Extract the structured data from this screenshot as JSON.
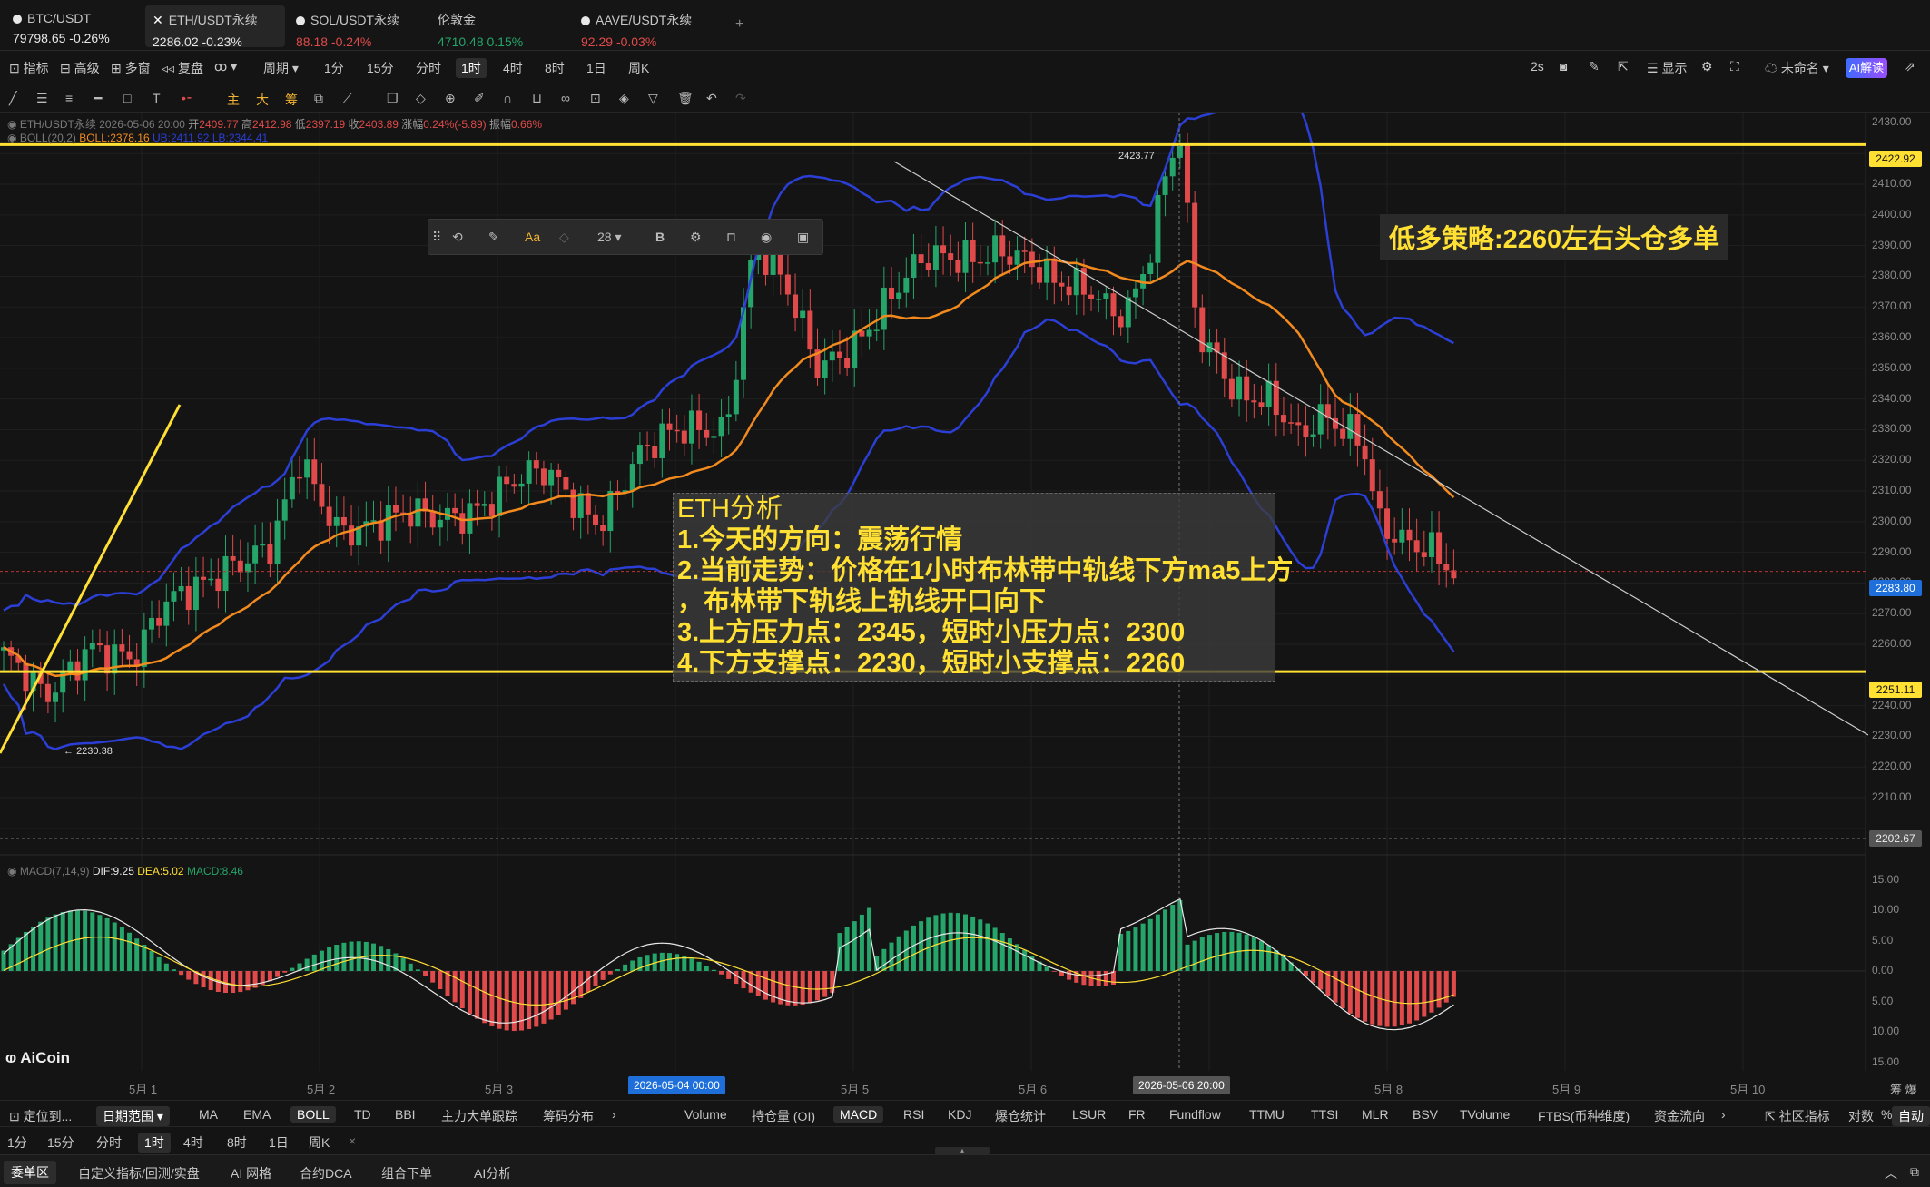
{
  "tabs": [
    {
      "name": "BTC/USDT",
      "price": "79798.65",
      "change": "-0.26%",
      "price_color": "#e8e8e8",
      "change_color": "#e8e8e8"
    },
    {
      "name": "ETH/USDT永续",
      "price": "2286.02",
      "change": "-0.23%",
      "price_color": "#e8e8e8",
      "change_color": "#e8e8e8"
    },
    {
      "name": "SOL/USDT永续",
      "price": "88.18",
      "change": "-0.24%",
      "price_color": "#e04a4a",
      "change_color": "#e04a4a"
    },
    {
      "name": "伦敦金",
      "price": "4710.48",
      "change": "0.15%",
      "price_color": "#25a56a",
      "change_color": "#25a56a"
    },
    {
      "name": "AAVE/USDT永续",
      "price": "92.29",
      "change": "-0.03%",
      "price_color": "#e04a4a",
      "change_color": "#e04a4a"
    }
  ],
  "add_tab_glyph": "+",
  "toolbar": {
    "indicator": "指标",
    "advanced": "高级",
    "multi_window": "多窗",
    "replay": "复盘",
    "period": "周期",
    "periods": [
      "1分",
      "15分",
      "分时",
      "1时",
      "4时",
      "8时",
      "1日",
      "周K"
    ],
    "selected_period": "1时",
    "interval": "2s",
    "display": "显示",
    "unnamed": "未命名",
    "ai_read": "AI解读"
  },
  "legend": {
    "symbol": "ETH/USDT永续",
    "datetime": "2026-05-06 20:00",
    "open_label": "开",
    "open": "2409.77",
    "high_label": "高",
    "high": "2412.98",
    "low_label": "低",
    "low": "2397.19",
    "close_label": "收",
    "close": "2403.89",
    "change_label": "涨幅",
    "change": "0.24%(-5.89)",
    "amplitude_label": "振幅",
    "amplitude": "0.66%",
    "boll_name": "BOLL(20,2)",
    "boll_mid": "BOLL:2378.16",
    "boll_up": "UB:2411.92",
    "boll_lb": "LB:2344.41"
  },
  "floating_toolbar": {
    "font_size": "28",
    "bold": "B"
  },
  "annotations": {
    "strategy": "低多策略:2260左右头仓多单",
    "analysis_lines": [
      "ETH分析",
      "1.今天的方向：震荡行情",
      "2.当前走势：价格在1小时布林带中轨线下方ma5上方",
      "，布林带下轨线上轨线开口向下",
      "3.上方压力点：2345，短时小压力点：2300",
      "4.下方支撑点：2230，短时小支撑点：2260"
    ],
    "high_marker": "2423.77",
    "low_marker": "2230.38"
  },
  "price_axis": {
    "labels": [
      "2430.00",
      "2410.00",
      "2400.00",
      "2390.00",
      "2380.00",
      "2370.00",
      "2360.00",
      "2350.00",
      "2340.00",
      "2330.00",
      "2320.00",
      "2310.00",
      "2300.00",
      "2290.00",
      "2280.00",
      "2270.00",
      "2260.00",
      "2240.00",
      "2230.00",
      "2220.00",
      "2210.00"
    ],
    "tag_resistance": "2422.92",
    "tag_last": "2283.80",
    "tag_support": "2251.11",
    "tag_crosshair": "2202.67",
    "tag_colors": {
      "line": "#ffe033",
      "last": "#1e6fd9",
      "crosshair": "#555555"
    }
  },
  "macd": {
    "name": "MACD(7,14,9)",
    "dif": "DIF:9.25",
    "dea": "DEA:5.02",
    "macd": "MACD:8.46",
    "axis": [
      "15.00",
      "10.00",
      "5.00",
      "0.00",
      "5.00",
      "10.00",
      "15.00"
    ]
  },
  "date_axis": {
    "labels": [
      "5月 1",
      "5月 2",
      "5月 3",
      "5月 4",
      "5月 5",
      "5月 6",
      "5月 7",
      "5月 8",
      "5月 9",
      "5月 10"
    ],
    "tag_selected": "2026-05-04 00:00",
    "tag_crosshair": "2026-05-06 20:00"
  },
  "logo": "AiCoin",
  "right_corner": "筹 爆",
  "indicator_bar": {
    "locate": "定位到...",
    "date_range": "日期范围",
    "main": [
      "MA",
      "EMA",
      "BOLL",
      "TD",
      "BBI",
      "主力大单跟踪",
      "筹码分布"
    ],
    "selected_main": "BOLL",
    "sub": [
      "Volume",
      "持仓量 (OI)",
      "MACD",
      "RSI",
      "KDJ",
      "爆仓统计",
      "LSUR",
      "FR",
      "Fundflow",
      "TTMU",
      "TTSI",
      "MLR",
      "BSV",
      "TVolume",
      "FTBS(币种维度)",
      "资金流向"
    ],
    "selected_sub": "MACD",
    "community": "社区指标",
    "log": "对数",
    "pct": "%",
    "auto": "自动"
  },
  "period_bar": [
    "1分",
    "15分",
    "分时",
    "1时",
    "4时",
    "8时",
    "1日",
    "周K"
  ],
  "bottom_tabs": [
    "委单区",
    "自定义指标/回测/实盘",
    "AI 网格",
    "合约DCA",
    "组合下单",
    "AI分析"
  ],
  "chart_data": {
    "type": "candlestick",
    "symbol": "ETH/USDT永续",
    "interval": "1时",
    "y_range": [
      2200,
      2430
    ],
    "horizontal_lines": [
      2422.92,
      2251.11
    ],
    "marked_high": 2423.77,
    "marked_low": 2230.38,
    "last_price": 2283.8,
    "series_names": [
      "BOLL UB",
      "BOLL MID",
      "BOLL LB"
    ],
    "note_colors": {
      "up": "#25a56a",
      "down": "#e04a4a",
      "boll_band": "#2b3fd6",
      "boll_mid": "#f28a1e",
      "hline": "#ffe033"
    }
  }
}
